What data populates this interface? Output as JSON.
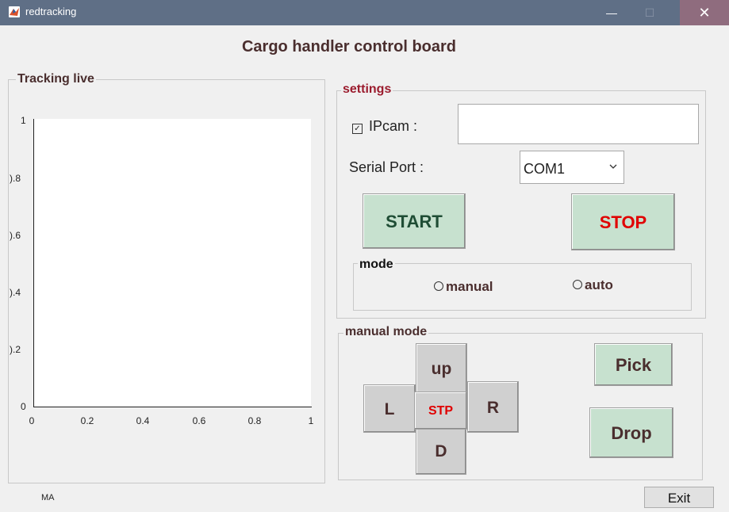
{
  "window": {
    "title": "redtracking",
    "minimize_glyph": "—",
    "maximize_glyph": "☐",
    "close_glyph": "✕",
    "app_icon": "matlab-icon"
  },
  "header": {
    "title": "Cargo handler control board"
  },
  "tracking": {
    "label": "Tracking live",
    "y_ticks": [
      "1",
      ").8",
      ").6",
      ").4",
      ").2",
      "0"
    ],
    "x_ticks": [
      "0",
      "0.2",
      "0.4",
      "0.6",
      "0.8",
      "1"
    ],
    "footer_text": "MA"
  },
  "settings": {
    "label": "settings",
    "ipcam_label": "IPcam :",
    "ipcam_checked": true,
    "ipcam_value": "",
    "serial_label": "Serial Port :",
    "serial_value": "COM1",
    "start_label": "START",
    "stop_label": "STOP",
    "mode": {
      "label": "mode",
      "manual_label": "manual",
      "auto_label": "auto"
    }
  },
  "manual_mode": {
    "label": "manual mode",
    "up": "up",
    "left": "L",
    "stop": "STP",
    "right": "R",
    "down": "D",
    "pick": "Pick",
    "drop": "Drop"
  },
  "exit_label": "Exit",
  "colors": {
    "titlebar": "#5f6f86",
    "close_bg": "#8f6c7e",
    "button_green": "#c7e1cf",
    "stop_red": "#e00000",
    "settings_label": "#9b1c2e"
  }
}
